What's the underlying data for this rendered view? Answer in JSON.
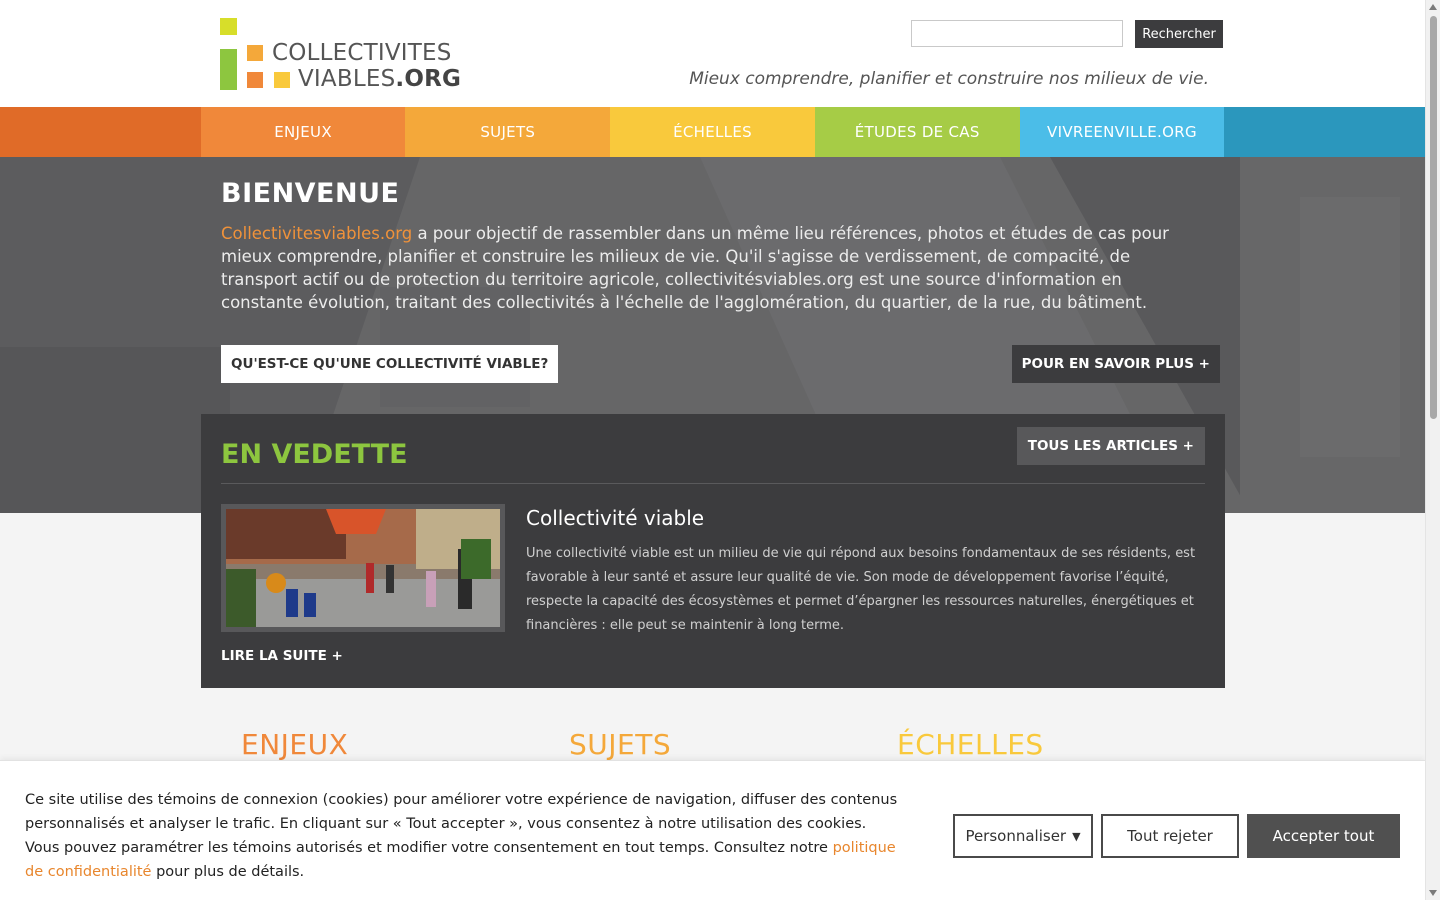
{
  "header": {
    "logo_line1": "COLLECTIVITES",
    "logo_line2_a": "VIABLES",
    "logo_line2_b": ".ORG",
    "search_button": "Rechercher",
    "search_value": "",
    "tagline": "Mieux comprendre, planifier et construire nos milieux de vie."
  },
  "nav": {
    "items": [
      {
        "label": "ENJEUX",
        "color": "#f0883a"
      },
      {
        "label": "SUJETS",
        "color": "#f4a83a"
      },
      {
        "label": "ÉCHELLES",
        "color": "#f9c93c"
      },
      {
        "label": "ÉTUDES DE CAS",
        "color": "#a6cc46"
      },
      {
        "label": "VIVREENVILLE.ORG",
        "color": "#4bbde8"
      }
    ]
  },
  "hero": {
    "title": "BIENVENUE",
    "link_text": "Collectivitesviables.org",
    "text": " a pour objectif de rassembler dans un même lieu références, photos et études de cas pour mieux comprendre, planifier et construire les milieux de vie. Qu'il s'agisse de verdissement, de compacité, de transport actif ou de protection du territoire agricole, collectivitésviables.org est une source d'information en constante évolution, traitant des collectivités à l'échelle de l'agglomération, du quartier, de la rue, du bâtiment.",
    "btn_what": "QU'EST-CE QU'UNE COLLECTIVITÉ VIABLE?",
    "btn_more": "POUR EN SAVOIR PLUS +"
  },
  "featured": {
    "title": "EN VEDETTE",
    "all_articles": "TOUS LES ARTICLES +",
    "article_title": "Collectivité viable",
    "article_text": "Une collectivité viable est un milieu de vie qui répond aux besoins fondamentaux de ses résidents, est favorable à leur santé et assure leur qualité de vie. Son mode de développement favorise l’équité, respecte la capacité des écosystèmes et permet d’épargner les ressources naturelles, énergétiques et financières : elle peut se maintenir à long terme.",
    "read_more": "LIRE LA SUITE +"
  },
  "sections": [
    {
      "label": "ENJEUX",
      "color": "#f0883a"
    },
    {
      "label": "SUJETS",
      "color": "#f4a83a"
    },
    {
      "label": "ÉCHELLES",
      "color": "#f9c93c"
    }
  ],
  "cookie": {
    "text_before": "Ce site utilise des témoins de connexion (cookies) pour améliorer votre expérience de navigation, diffuser des contenus personnalisés et analyser le trafic. En cliquant sur « Tout accepter », vous consentez à notre utilisation des cookies. Vous pouvez paramétrer les témoins autorisés et modifier votre consentement en tout temps. Consultez notre ",
    "link": "politique de confidentialité",
    "text_after": " pour plus de détails.",
    "btn_customize": "Personnaliser",
    "btn_reject": "Tout rejeter",
    "btn_accept": "Accepter tout"
  }
}
